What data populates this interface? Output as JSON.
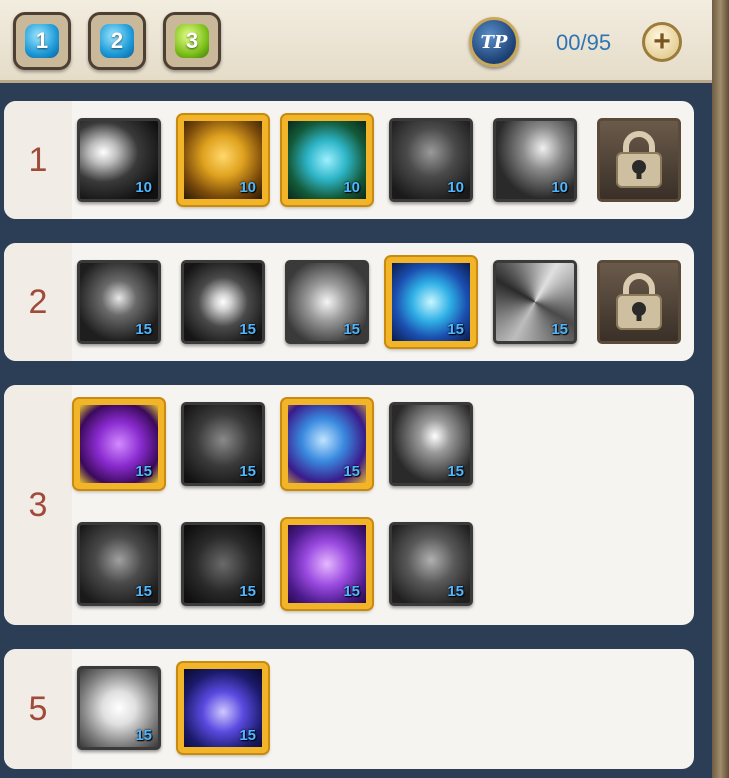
{
  "header": {
    "tabs": [
      {
        "label": "1",
        "color": "blue"
      },
      {
        "label": "2",
        "color": "blue"
      },
      {
        "label": "3",
        "color": "green"
      }
    ],
    "tp_label": "TP",
    "tp_count": "00/95",
    "plus_icon": "plus-icon"
  },
  "rows": [
    {
      "label": "1",
      "skills": [
        {
          "level": "10",
          "selected": false,
          "icon": "slash-icon"
        },
        {
          "level": "10",
          "selected": true,
          "icon": "golden-armor-icon"
        },
        {
          "level": "10",
          "selected": true,
          "icon": "blue-beast-icon"
        },
        {
          "level": "10",
          "selected": false,
          "icon": "warrior-aura-icon"
        },
        {
          "level": "10",
          "selected": false,
          "icon": "sword-strike-icon"
        },
        {
          "locked": true,
          "icon": "lock-icon"
        }
      ]
    },
    {
      "label": "2",
      "skills": [
        {
          "level": "15",
          "selected": false,
          "icon": "skull-lightning-icon"
        },
        {
          "level": "15",
          "selected": false,
          "icon": "burst-icon"
        },
        {
          "level": "15",
          "selected": false,
          "icon": "meditation-icon"
        },
        {
          "level": "15",
          "selected": true,
          "icon": "crystal-shield-icon"
        },
        {
          "level": "15",
          "selected": false,
          "icon": "vortex-icon"
        },
        {
          "locked": true,
          "icon": "lock-icon"
        }
      ]
    },
    {
      "label": "3",
      "skills": [
        {
          "level": "15",
          "selected": true,
          "icon": "purple-creature-icon"
        },
        {
          "level": "15",
          "selected": false,
          "icon": "dark-creature-icon"
        },
        {
          "level": "15",
          "selected": true,
          "icon": "blue-orb-slash-icon"
        },
        {
          "level": "15",
          "selected": false,
          "icon": "skull-slash-icon"
        },
        {
          "level": "15",
          "selected": false,
          "icon": "dark-golem-icon"
        },
        {
          "level": "15",
          "selected": false,
          "icon": "dark-rider-icon"
        },
        {
          "level": "15",
          "selected": true,
          "icon": "violet-flower-icon"
        },
        {
          "level": "15",
          "selected": false,
          "icon": "stone-beast-icon"
        }
      ]
    },
    {
      "label": "5",
      "skills": [
        {
          "level": "15",
          "selected": false,
          "icon": "white-flash-icon"
        },
        {
          "level": "15",
          "selected": true,
          "icon": "cosmic-spire-icon"
        }
      ]
    }
  ],
  "colors": {
    "selected_border": "#f2b52a",
    "level_text": "#4fb6ff",
    "row_label": "#a04a3a",
    "panel_bg": "#2c3e56"
  }
}
